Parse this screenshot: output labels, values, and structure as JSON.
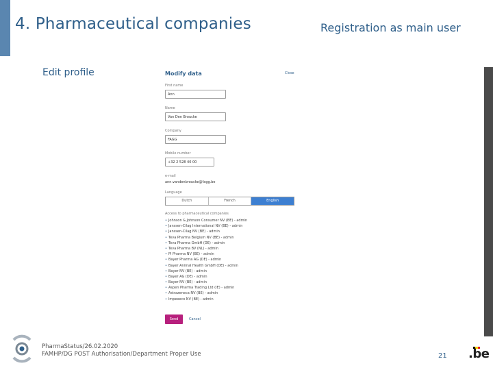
{
  "slide": {
    "title": "4. Pharmaceutical companies",
    "subtitle": "Registration as main user",
    "section": "Edit profile",
    "accent_color": "#5a86b0"
  },
  "form": {
    "heading": "Modify data",
    "close": "Close",
    "fields": [
      {
        "label": "First name",
        "value": "Ann"
      },
      {
        "label": "Name",
        "value": "Van Den Broucke"
      },
      {
        "label": "Company",
        "value": "FAGG"
      },
      {
        "label": "Mobile number",
        "value": "+32 2 528 40 00"
      }
    ],
    "email_label": "e-mail",
    "email_value": "ann.vandenbroucke@fagg.be",
    "language_label": "Language",
    "languages": [
      "Dutch",
      "French",
      "English"
    ],
    "selected_language": "English",
    "access_label": "Access to pharmaceutical companies",
    "access_items": [
      "Johnson & Johnson Consumer NV (BE) - admin",
      "Janssen-Cilag International NV (BE) - admin",
      "Janssen-Cilag NV (BE) - admin",
      "Teva Pharma Belgium NV (BE) - admin",
      "Teva Pharma GmbH (DE) - admin",
      "Teva Pharma BV (NL) - admin",
      "PI Pharma NV (BE) - admin",
      "Bayer Pharma AG (DE) - admin",
      "Bayer Animal Health GmbH (DE) - admin",
      "Bayer NV (BE) - admin",
      "Bayer AG (DE) - admin",
      "Bayer NV (BE) - admin",
      "Aspen Pharma Trading Ltd (IE) - admin",
      "Astrazeneca NV (BE) - admin",
      "Impexeco NV (BE) - admin"
    ],
    "send": "Send",
    "cancel": "Cancel",
    "send_color": "#b7207d",
    "active_lang_color": "#3d7fd1"
  },
  "footer": {
    "line1": "PharmaStatus/26.02.2020",
    "line2": "FAMHP/DG POST Authorisation/Department Proper Use",
    "page_number": "21",
    "be_logo": ".be",
    "logo_icon": "famhp-logo-icon"
  }
}
